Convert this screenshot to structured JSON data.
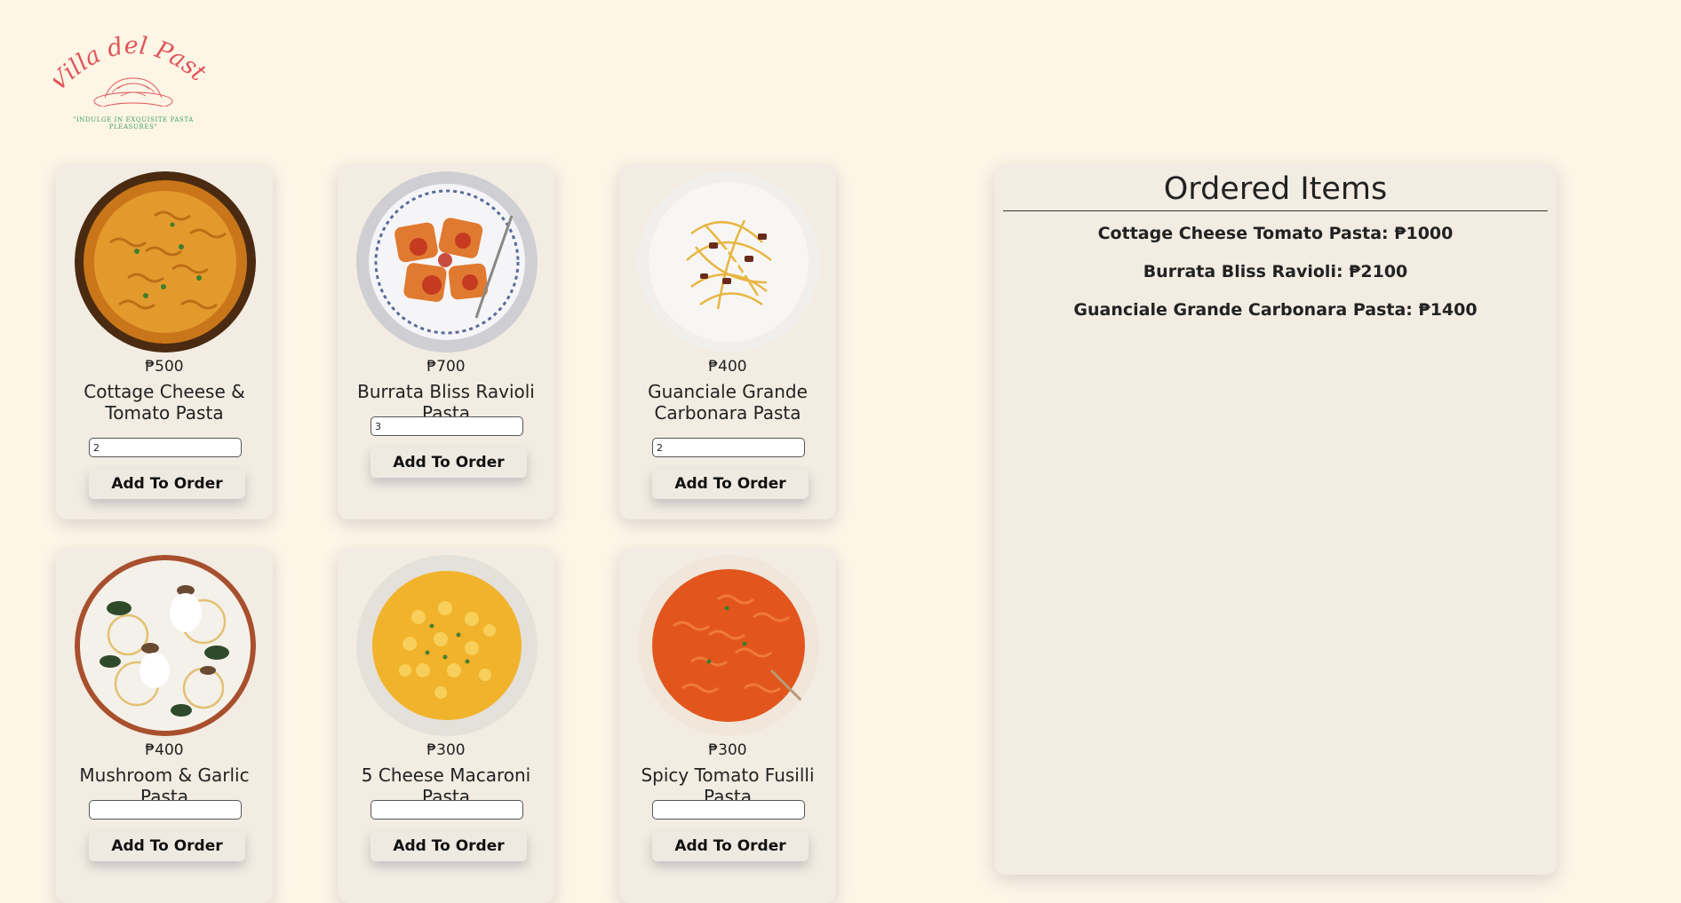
{
  "logo": {
    "name": "Villa del Pasta",
    "tagline": "\"INDULGE IN EXQUISITE PASTA PLEASURES\""
  },
  "menu": {
    "items": [
      {
        "price": "₱500",
        "name": "Cottage Cheese & Tomato Pasta",
        "quantity": "2",
        "button": "Add To Order",
        "image": "fusilli-pan-icon"
      },
      {
        "price": "₱700",
        "name": "Burrata Bliss Ravioli Pasta",
        "quantity": "3",
        "button": "Add To Order",
        "image": "ravioli-plate-icon"
      },
      {
        "price": "₱400",
        "name": "Guanciale Grande Carbonara Pasta",
        "quantity": "2",
        "button": "Add To Order",
        "image": "carbonara-plate-icon"
      },
      {
        "price": "₱400",
        "name": "Mushroom & Garlic Pasta",
        "quantity": "",
        "button": "Add To Order",
        "image": "mushroom-pasta-plate-icon"
      },
      {
        "price": "₱300",
        "name": "5 Cheese Macaroni Pasta",
        "quantity": "",
        "button": "Add To Order",
        "image": "macaroni-bowl-icon"
      },
      {
        "price": "₱300",
        "name": "Spicy Tomato Fusilli Pasta",
        "quantity": "",
        "button": "Add To Order",
        "image": "fusilli-bowl-icon"
      }
    ]
  },
  "orders": {
    "title": "Ordered Items",
    "items": [
      "Cottage Cheese Tomato Pasta: ₱1000",
      "Burrata Bliss Ravioli: ₱2100",
      "Guanciale Grande Carbonara Pasta: ₱1400"
    ]
  },
  "colors": {
    "page_background": "#fdf5e6",
    "card_background": "#f2ece2",
    "logo_red": "#e0565a",
    "tagline_green": "#3aa067"
  }
}
